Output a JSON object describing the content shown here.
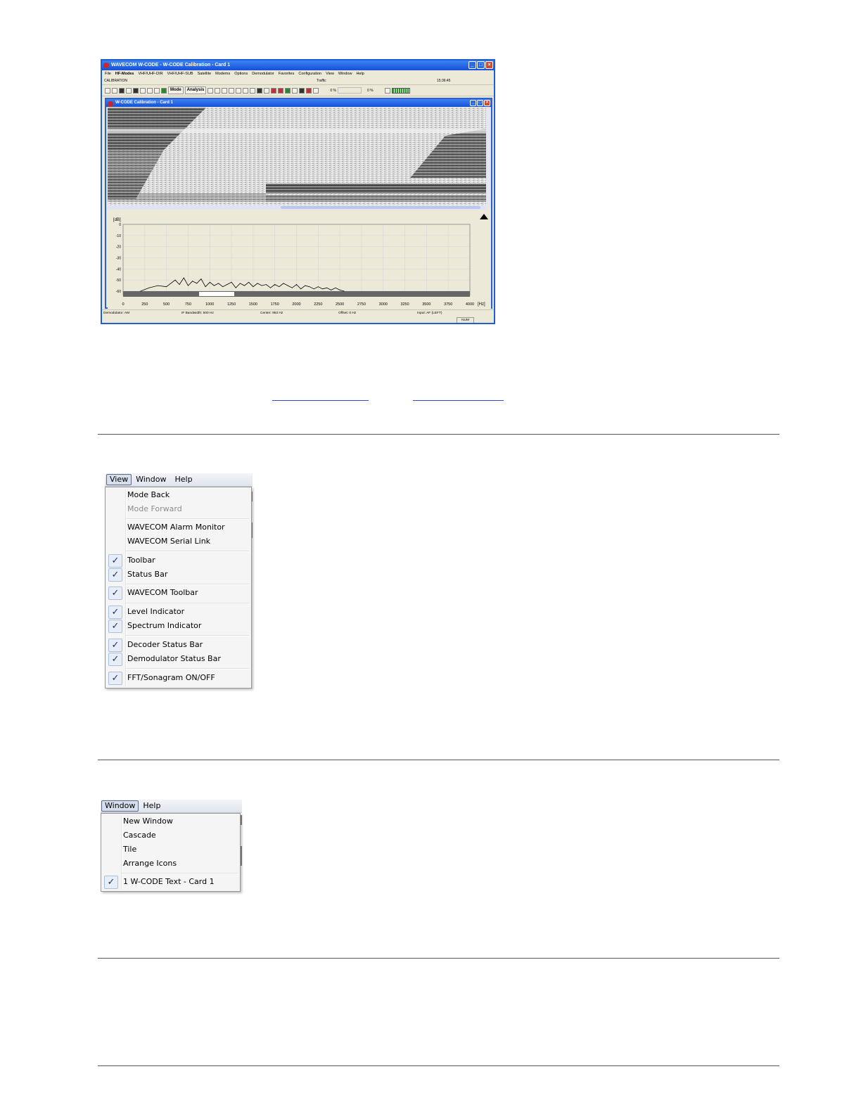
{
  "app_window": {
    "title": "WAVECOM W-CODE - W-CODE Calibration - Card 1",
    "menu": [
      "File",
      "HF-Modes",
      "VHF/UHF-DIR",
      "VHF/UHF-SUB",
      "Satellite",
      "Modems",
      "Options",
      "Demodulator",
      "Favorites",
      "Configuration",
      "View",
      "Window",
      "Help"
    ],
    "status_top": {
      "mode": "CALIBRATION",
      "traffic": "Traffic",
      "time": "15:36:45"
    },
    "toolbar": {
      "mode_label": "Mode",
      "analysis_label": "Analysis",
      "pct1": "0 %",
      "pct2": "0 %"
    },
    "child_window": {
      "title": "W-CODE Calibration - Card 1",
      "fft": {
        "y_unit": "[dB]",
        "y_ticks": [
          "0",
          "-10",
          "-20",
          "-30",
          "-40",
          "-50",
          "-60"
        ],
        "x_ticks": [
          "0",
          "250",
          "500",
          "750",
          "1000",
          "1250",
          "1500",
          "1750",
          "2000",
          "2250",
          "2500",
          "2750",
          "3000",
          "3250",
          "3500",
          "3750",
          "4000"
        ],
        "x_unit": "[Hz]"
      }
    },
    "status_bottom": {
      "demodulator": "Demodulator: AM",
      "bandwidth": "IF Bandwidth: 500 Hz",
      "center": "Center: 953 Hz",
      "offset": "Offset: 0 Hz",
      "input": "Input: AF (LEFT)",
      "num": "NUM"
    }
  },
  "chart_data": {
    "type": "line",
    "xlabel": "[Hz]",
    "ylabel": "[dB]",
    "xlim": [
      0,
      4000
    ],
    "ylim": [
      -60,
      0
    ],
    "x": [
      200,
      300,
      400,
      500,
      600,
      650,
      700,
      750,
      800,
      850,
      900,
      950,
      1000,
      1050,
      1100,
      1150,
      1200,
      1250,
      1300,
      1350,
      1400,
      1450,
      1500,
      1550,
      1600,
      1650,
      1700,
      1750,
      1800,
      1850,
      1900,
      1950,
      2000,
      2050,
      2100,
      2150,
      2200,
      2250,
      2300,
      2350,
      2400,
      2450,
      2500,
      2550
    ],
    "y": [
      -60,
      -57,
      -55,
      -56,
      -50,
      -54,
      -48,
      -55,
      -51,
      -53,
      -49,
      -56,
      -52,
      -55,
      -53,
      -56,
      -54,
      -52,
      -57,
      -53,
      -55,
      -52,
      -56,
      -53,
      -55,
      -54,
      -57,
      -54,
      -56,
      -53,
      -55,
      -57,
      -54,
      -58,
      -55,
      -56,
      -58,
      -56,
      -58,
      -57,
      -59,
      -57,
      -59,
      -60
    ],
    "grid": true
  },
  "view_menu": {
    "header": [
      "View",
      "Window",
      "Help"
    ],
    "items": [
      {
        "label": "Mode Back",
        "checked": false,
        "disabled": false
      },
      {
        "label": "Mode Forward",
        "checked": false,
        "disabled": true
      },
      {
        "label": "WAVECOM Alarm Monitor",
        "checked": false,
        "disabled": false
      },
      {
        "label": "WAVECOM Serial Link",
        "checked": false,
        "disabled": false
      },
      {
        "label": "Toolbar",
        "checked": true,
        "disabled": false
      },
      {
        "label": "Status Bar",
        "checked": true,
        "disabled": false
      },
      {
        "label": "WAVECOM Toolbar",
        "checked": true,
        "disabled": false
      },
      {
        "label": "Level Indicator",
        "checked": true,
        "disabled": false
      },
      {
        "label": "Spectrum Indicator",
        "checked": true,
        "disabled": false
      },
      {
        "label": "Decoder Status Bar",
        "checked": true,
        "disabled": false
      },
      {
        "label": "Demodulator Status Bar",
        "checked": true,
        "disabled": false
      },
      {
        "label": "FFT/Sonagram ON/OFF",
        "checked": true,
        "disabled": false
      }
    ]
  },
  "window_menu": {
    "header": [
      "Window",
      "Help"
    ],
    "items": [
      {
        "label": "New Window",
        "checked": false
      },
      {
        "label": "Cascade",
        "checked": false
      },
      {
        "label": "Tile",
        "checked": false
      },
      {
        "label": "Arrange Icons",
        "checked": false
      },
      {
        "label": "1 W-CODE Text  - Card 1",
        "checked": true
      }
    ]
  }
}
